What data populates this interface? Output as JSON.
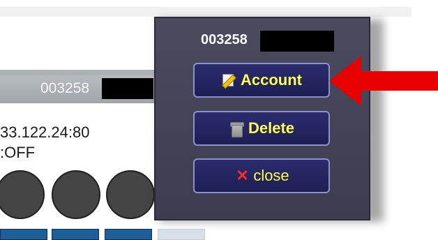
{
  "device_panel": {
    "id_prefix": "003258",
    "ip_text": "33.122.24:80",
    "status_text": ":OFF"
  },
  "popup": {
    "title_prefix": "003258",
    "buttons": [
      {
        "label": "Account",
        "icon": "note-pencil-icon"
      },
      {
        "label": "Delete",
        "icon": "trash-icon"
      },
      {
        "label": "close",
        "icon": "close-x-icon"
      }
    ]
  },
  "colors": {
    "popup_bg": "#3f3f52",
    "button_bg": "#23255f",
    "button_label": "#ffff66",
    "arrow": "#e60000"
  }
}
